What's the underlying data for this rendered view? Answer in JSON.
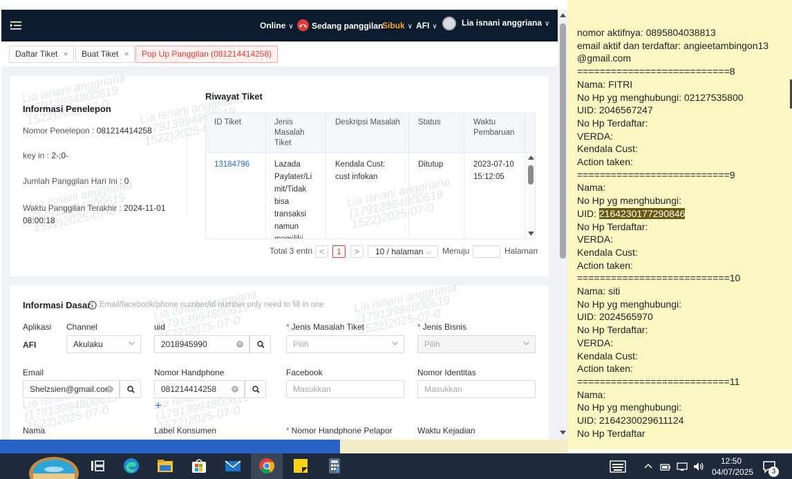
{
  "topbar": {
    "status": "Online",
    "call_status": "Sedang panggilan",
    "busy": "Sibuk",
    "product": "AFI",
    "user_name": "Lia isnani anggriana"
  },
  "tabs": [
    {
      "label": "Daftar Tiket",
      "close": "×"
    },
    {
      "label": "Buat Tiket",
      "close": "×"
    },
    {
      "label": "Pop Up Panggilan (081214414258)"
    }
  ],
  "caller_info": {
    "title": "Informasi Penelepon",
    "phone_label": "Nomor Penelepon :",
    "phone_value": "081214414258",
    "keyin_label": "key in :",
    "keyin_value": "2-;0-",
    "calls_today_label": "Jumlah Panggilan Hari Ini :",
    "calls_today_value": "0",
    "last_call_label": "Waktu Panggilan Terakhir :",
    "last_call_value_1": "2024-11-01",
    "last_call_value_2": "08:00:18"
  },
  "ticket_history": {
    "title": "Riwayat Tiket",
    "columns": [
      "ID Tiket",
      "Jenis\nMasalah\nTiket",
      "Deskripsi Masalah",
      "Status",
      "Waktu\nPembaruan"
    ],
    "row": {
      "id": "13184796",
      "type": "Lazada\nPaylater/Li\nmit/Tidak\nbisa\ntransaksi\nnamun\nmemiliki",
      "desc": "Kendala Cust:\ncust infokan",
      "status": "Ditutup",
      "updated": "2023-07-10\n15:12:05"
    },
    "pagination": {
      "total": "Total 3 entri",
      "prev": "<",
      "page": "1",
      "next": ">",
      "page_size": "10 / halaman",
      "goto_label": "Menuju",
      "page_suffix": "Halaman"
    }
  },
  "basic_info": {
    "title": "Informasi Dasar",
    "hint": "Email/facebook/phone number/id number only need to fill in one",
    "app_label": "Aplikasi",
    "app_value": "AFI",
    "channel_label": "Channel",
    "channel_value": "Akulaku",
    "uid_label": "uid",
    "uid_value": "2018945990",
    "issue_type_label": "Jenis Masalah Tiket",
    "issue_type_placeholder": "Pilih",
    "business_type_label": "Jenis Bisnis",
    "business_type_placeholder": "Pilih",
    "email_label": "Email",
    "email_value": "Shelzsien@gmail.com",
    "phone_label": "Nomor Handphone",
    "phone_value": "081214414258",
    "add": "+",
    "facebook_label": "Facebook",
    "facebook_placeholder": "Masukkan",
    "id_number_label": "Nomor Identitas",
    "id_number_placeholder": "Masukkan",
    "name_label": "Nama",
    "customer_label_label": "Label Konsumen",
    "reporter_phone_label": "Nomor Handphone Pelapor",
    "incident_time_label": "Waktu Kejadian"
  },
  "watermark": {
    "line1": "Lia isnani anggriana",
    "line2": "(17913994800619",
    "line3": "1522)2025-07-0"
  },
  "notepad": {
    "line_01": "nomor aktifnya: 0895804038813",
    "line_02": "email aktif dan terdaftar: angieetambingon13",
    "line_03": "@gmail.com",
    "line_04": "",
    "line_05": "===========================8",
    "line_06": "Nama: FITRI",
    "line_07": "No Hp yg menghubungi: 02127535800",
    "line_08": "UID: 2046567247",
    "line_09": "No Hp Terdaftar:",
    "line_10": "VERDA:",
    "line_11": "Kendala Cust:",
    "line_12": "Action taken:",
    "line_13": "===========================9",
    "line_14": "Nama:",
    "line_15": "No Hp yg menghubungi:",
    "line_16_prefix": "UID: ",
    "line_16_highlight": "2164230177290846",
    "line_17": "No Hp Terdaftar:",
    "line_18": "VERDA:",
    "line_19": "Kendala Cust:",
    "line_20": "Action taken:",
    "line_21": "===========================10",
    "line_22": "Nama: siti",
    "line_23": "No Hp yg menghubungi:",
    "line_24": "UID: 2024565970",
    "line_25": "No Hp Terdaftar:",
    "line_26": "VERDA:",
    "line_27": "Kendala Cust:",
    "line_28": "Action taken:",
    "line_29": "===========================11",
    "line_30": "Nama:",
    "line_31": "No Hp yg menghubungi:",
    "line_32": "UID: 2164230029611124",
    "line_33": "No Hp Terdaftar"
  },
  "taskbar": {
    "time": "12:50",
    "date": "04/07/2025",
    "notifications": "3",
    "apps": [
      "task-view-icon",
      "edge-icon",
      "file-explorer-icon",
      "store-icon",
      "mail-icon",
      "chrome-icon",
      "sticky-notes-icon",
      "calculator-icon"
    ]
  },
  "colors": {
    "topbar": "#0d1b2e",
    "busy": "#f5a623",
    "call_red": "#e53935",
    "link": "#1a6fd0",
    "notepad_bg": "#fdf7c4",
    "highlight": "#6b5b12"
  }
}
